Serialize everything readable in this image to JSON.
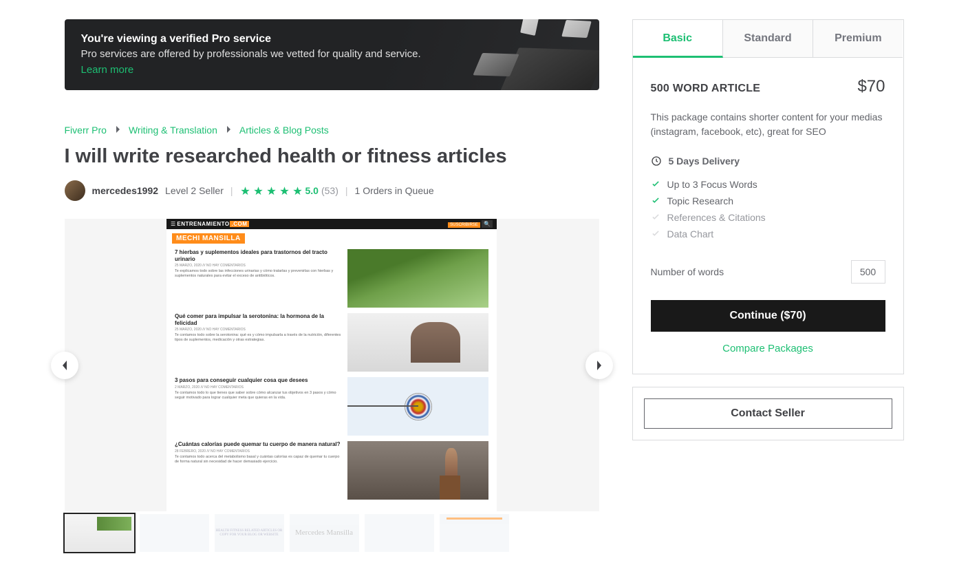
{
  "pro_banner": {
    "title": "You're viewing a verified Pro service",
    "subtitle": "Pro services are offered by professionals we vetted for quality and service.",
    "learn_more": "Learn more"
  },
  "breadcrumb": [
    "Fiverr Pro",
    "Writing & Translation",
    "Articles & Blog Posts"
  ],
  "gig_title": "I will write researched health or fitness articles",
  "seller": {
    "username": "mercedes1992",
    "level": "Level 2 Seller",
    "rating": "5.0",
    "reviews": "(53)",
    "queue": "1 Orders in Queue"
  },
  "gallery": {
    "domain_a": "ENTRENAMIENTO",
    "domain_b": ".COM",
    "subscribe": "SUSCRIBIRSE",
    "byline": "MECHI MANSILLA",
    "posts": [
      {
        "title": "7 hierbas y suplementos ideales para trastornos del tracto urinario",
        "meta": "25 MARZO, 2020 /// NO HAY COMENTARIOS",
        "desc": "Te explicamos todo sobre las infecciones urinarias y cómo tratarlas y prevenirlas con hierbas y suplementos naturales para evitar el exceso de antibióticos."
      },
      {
        "title": "Qué comer para impulsar la serotonina: la hormona de la felicidad",
        "meta": "25 MARZO, 2020 /// NO HAY COMENTARIOS",
        "desc": "Te contamos todo sobre la serotonina: qué es y cómo impulsarla a través de la nutrición, diferentes tipos de suplementos, medicación y otras estrategias."
      },
      {
        "title": "3 pasos para conseguir cualquier cosa que desees",
        "meta": "2 MARZO, 2020 /// NO HAY COMENTARIOS",
        "desc": "Te contamos todo lo que tienes que saber sobre cómo alcanzar tus objetivos en 3 pasos y cómo seguir motivado para lograr cualquier meta que quieras en la vida."
      },
      {
        "title": "¿Cuántas calorías puede quemar tu cuerpo de manera natural?",
        "meta": "28 FEBRERO, 2020 /// NO HAY COMENTARIOS",
        "desc": "Te contamos todo acerca del metabolismo basal y cuántas calorías es capaz de quemar tu cuerpo de forma natural sin necesidad de hacer demasiado ejercicio."
      }
    ],
    "thumb4_text": "Mercedes Mansilla"
  },
  "packages": {
    "tabs": [
      "Basic",
      "Standard",
      "Premium"
    ],
    "name": "500 WORD ARTICLE",
    "price": "$70",
    "desc": "This package contains shorter content for your medias (instagram, facebook, etc), great for SEO",
    "delivery": "5 Days Delivery",
    "features": [
      {
        "label": "Up to 3 Focus Words",
        "on": true
      },
      {
        "label": "Topic Research",
        "on": true
      },
      {
        "label": "References & Citations",
        "on": false
      },
      {
        "label": "Data Chart",
        "on": false
      }
    ],
    "words_label": "Number of words",
    "words_value": "500",
    "continue": "Continue ($70)",
    "compare": "Compare Packages",
    "contact": "Contact Seller"
  }
}
